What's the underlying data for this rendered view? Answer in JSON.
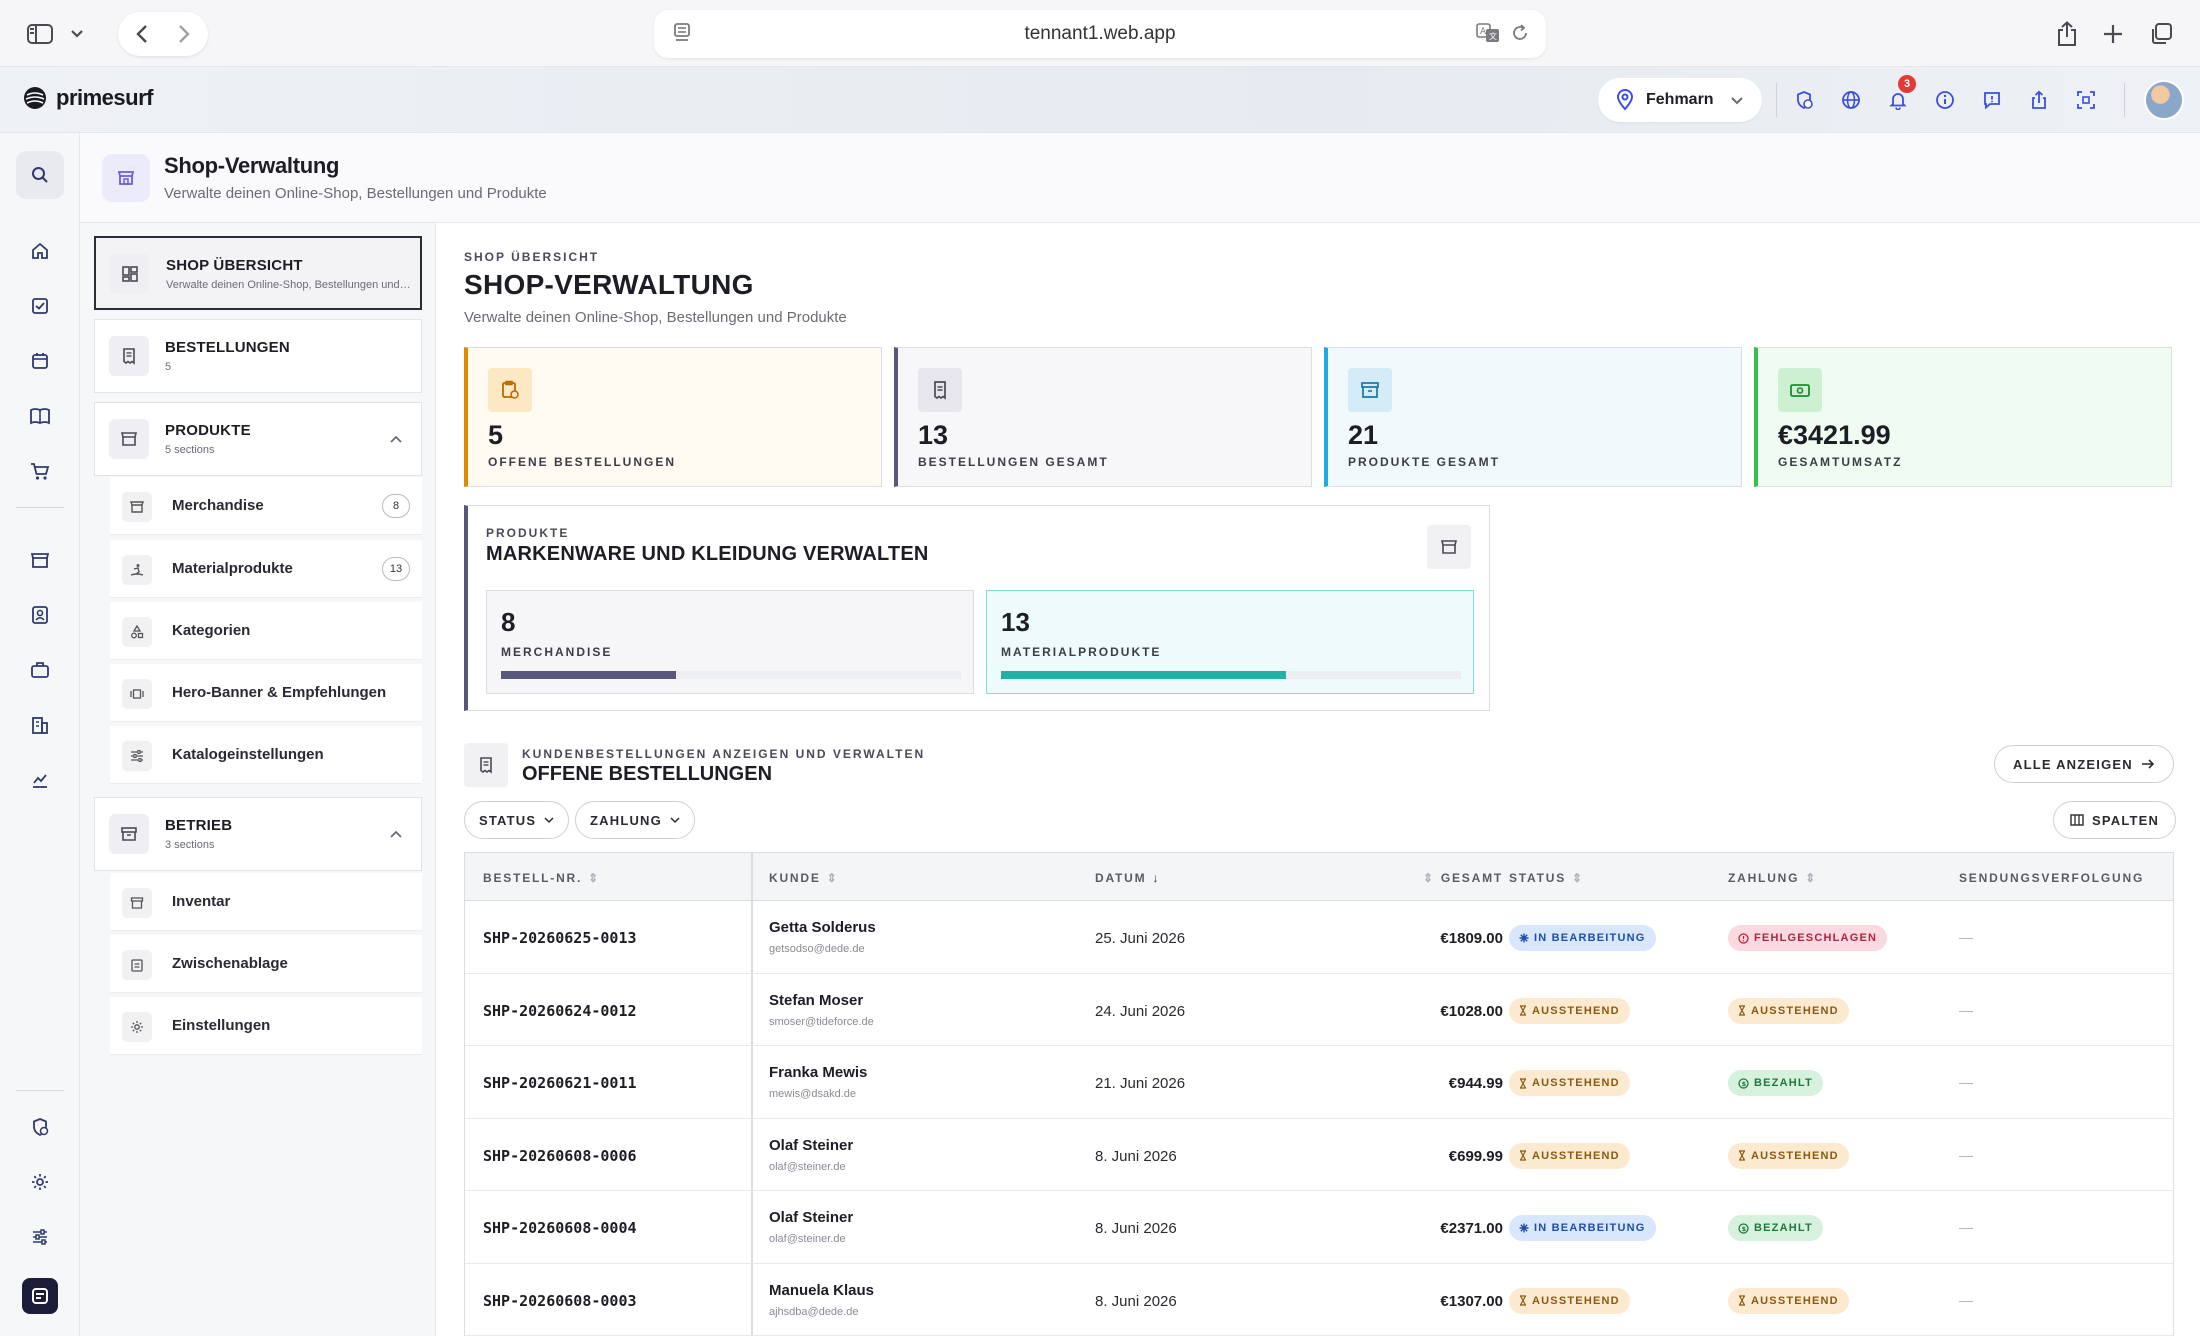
{
  "browser": {
    "url": "tennant1.web.app"
  },
  "header": {
    "brand": "primesurf",
    "location": "Fehmarn",
    "notification_count": "3",
    "icons": [
      "shield-clock-icon",
      "globe-icon",
      "bell-icon",
      "info-icon",
      "message-icon",
      "share-icon",
      "scan-icon"
    ]
  },
  "page": {
    "title": "Shop-Verwaltung",
    "subtitle": "Verwalte deinen Online-Shop, Bestellungen und Produkte"
  },
  "subnav": {
    "overview": {
      "title": "SHOP ÜBERSICHT",
      "sub": "Verwalte deinen Online-Shop, Bestellungen und Produkte"
    },
    "orders": {
      "title": "BESTELLUNGEN",
      "sub": "5"
    },
    "products": {
      "title": "PRODUKTE",
      "sub": "5 sections",
      "items": [
        {
          "label": "Merchandise",
          "count": "8"
        },
        {
          "label": "Materialprodukte",
          "count": "13"
        },
        {
          "label": "Kategorien"
        },
        {
          "label": "Hero-Banner & Empfehlungen"
        },
        {
          "label": "Katalogeinstellungen"
        }
      ]
    },
    "operations": {
      "title": "BETRIEB",
      "sub": "3 sections",
      "items": [
        {
          "label": "Inventar"
        },
        {
          "label": "Zwischenablage"
        },
        {
          "label": "Einstellungen"
        }
      ]
    }
  },
  "main": {
    "overline": "SHOP ÜBERSICHT",
    "title": "SHOP-VERWALTUNG",
    "subtitle": "Verwalte deinen Online-Shop, Bestellungen und Produkte",
    "stats": [
      {
        "value": "5",
        "label": "OFFENE BESTELLUNGEN",
        "accent": "#e08a00",
        "bg": "#fffbf2",
        "icon_bg": "#fde8c4",
        "icon_color": "#b86a00"
      },
      {
        "value": "13",
        "label": "BESTELLUNGEN GESAMT",
        "accent": "#57587a",
        "bg": "#f7f7f9",
        "icon_bg": "#e6e6ec",
        "icon_color": "#4a4a58"
      },
      {
        "value": "21",
        "label": "PRODUKTE GESAMT",
        "accent": "#22a9e0",
        "bg": "#f1f9fd",
        "icon_bg": "#d3ecf8",
        "icon_color": "#1679a8"
      },
      {
        "value": "€3421.99",
        "label": "GESAMTUMSATZ",
        "accent": "#34c04a",
        "bg": "#f0fbf1",
        "icon_bg": "#cdf0d2",
        "icon_color": "#1e8a33"
      }
    ],
    "products_card": {
      "overline": "PRODUKTE",
      "title": "MARKENWARE UND KLEIDUNG VERWALTEN",
      "tiles": [
        {
          "value": "8",
          "label": "MERCHANDISE",
          "progress": 0.38,
          "color": "#57587a",
          "border": "#dcdde3",
          "bg": "#f6f6f8"
        },
        {
          "value": "13",
          "label": "MATERIALPRODUKTE",
          "progress": 0.62,
          "color": "#1fb3a6",
          "border": "#7fe0d6",
          "bg": "#effbfa"
        }
      ]
    },
    "orders": {
      "overline": "KUNDENBESTELLUNGEN ANZEIGEN UND VERWALTEN",
      "title": "OFFENE BESTELLUNGEN",
      "show_all": "ALLE ANZEIGEN",
      "filter_status": "STATUS",
      "filter_payment": "ZAHLUNG",
      "columns_btn": "SPALTEN",
      "columns": [
        "BESTELL-NR.",
        "KUNDE",
        "DATUM",
        "GESAMT",
        "STATUS",
        "ZAHLUNG",
        "SENDUNGSVERFOLGUNG"
      ],
      "rows": [
        {
          "id": "SHP-20260625-0013",
          "name": "Getta Solderus",
          "email": "getsodso@dede.de",
          "date": "25. Juni 2026",
          "total": "€1809.00",
          "status": "IN BEARBEITUNG",
          "status_type": "info",
          "payment": "FEHLGESCHLAGEN",
          "payment_type": "err",
          "tracking": "—"
        },
        {
          "id": "SHP-20260624-0012",
          "name": "Stefan Moser",
          "email": "smoser@tideforce.de",
          "date": "24. Juni 2026",
          "total": "€1028.00",
          "status": "AUSSTEHEND",
          "status_type": "warn",
          "payment": "AUSSTEHEND",
          "payment_type": "warn",
          "tracking": "—"
        },
        {
          "id": "SHP-20260621-0011",
          "name": "Franka Mewis",
          "email": "mewis@dsakd.de",
          "date": "21. Juni 2026",
          "total": "€944.99",
          "status": "AUSSTEHEND",
          "status_type": "warn",
          "payment": "BEZAHLT",
          "payment_type": "ok",
          "tracking": "—"
        },
        {
          "id": "SHP-20260608-0006",
          "name": "Olaf Steiner",
          "email": "olaf@steiner.de",
          "date": "8. Juni 2026",
          "total": "€699.99",
          "status": "AUSSTEHEND",
          "status_type": "warn",
          "payment": "AUSSTEHEND",
          "payment_type": "warn",
          "tracking": "—"
        },
        {
          "id": "SHP-20260608-0004",
          "name": "Olaf Steiner",
          "email": "olaf@steiner.de",
          "date": "8. Juni 2026",
          "total": "€2371.00",
          "status": "IN BEARBEITUNG",
          "status_type": "info",
          "payment": "BEZAHLT",
          "payment_type": "ok",
          "tracking": "—"
        },
        {
          "id": "SHP-20260608-0003",
          "name": "Manuela Klaus",
          "email": "ajhsdba@dede.de",
          "date": "8. Juni 2026",
          "total": "€1307.00",
          "status": "AUSSTEHEND",
          "status_type": "warn",
          "payment": "AUSSTEHEND",
          "payment_type": "warn",
          "tracking": "—"
        }
      ]
    }
  }
}
